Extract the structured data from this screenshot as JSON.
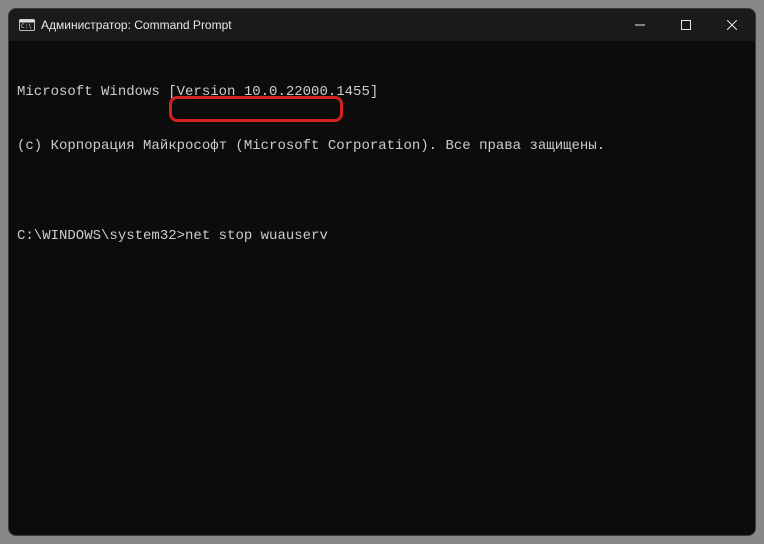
{
  "titlebar": {
    "title": "Администратор: Command Prompt"
  },
  "terminal": {
    "line1": "Microsoft Windows [Version 10.0.22000.1455]",
    "line2": "(c) Корпорация Майкрософт (Microsoft Corporation). Все права защищены.",
    "blank": "",
    "prompt": "C:\\WINDOWS\\system32>",
    "command": "net stop wuauserv"
  },
  "colors": {
    "highlight": "#d32020"
  }
}
